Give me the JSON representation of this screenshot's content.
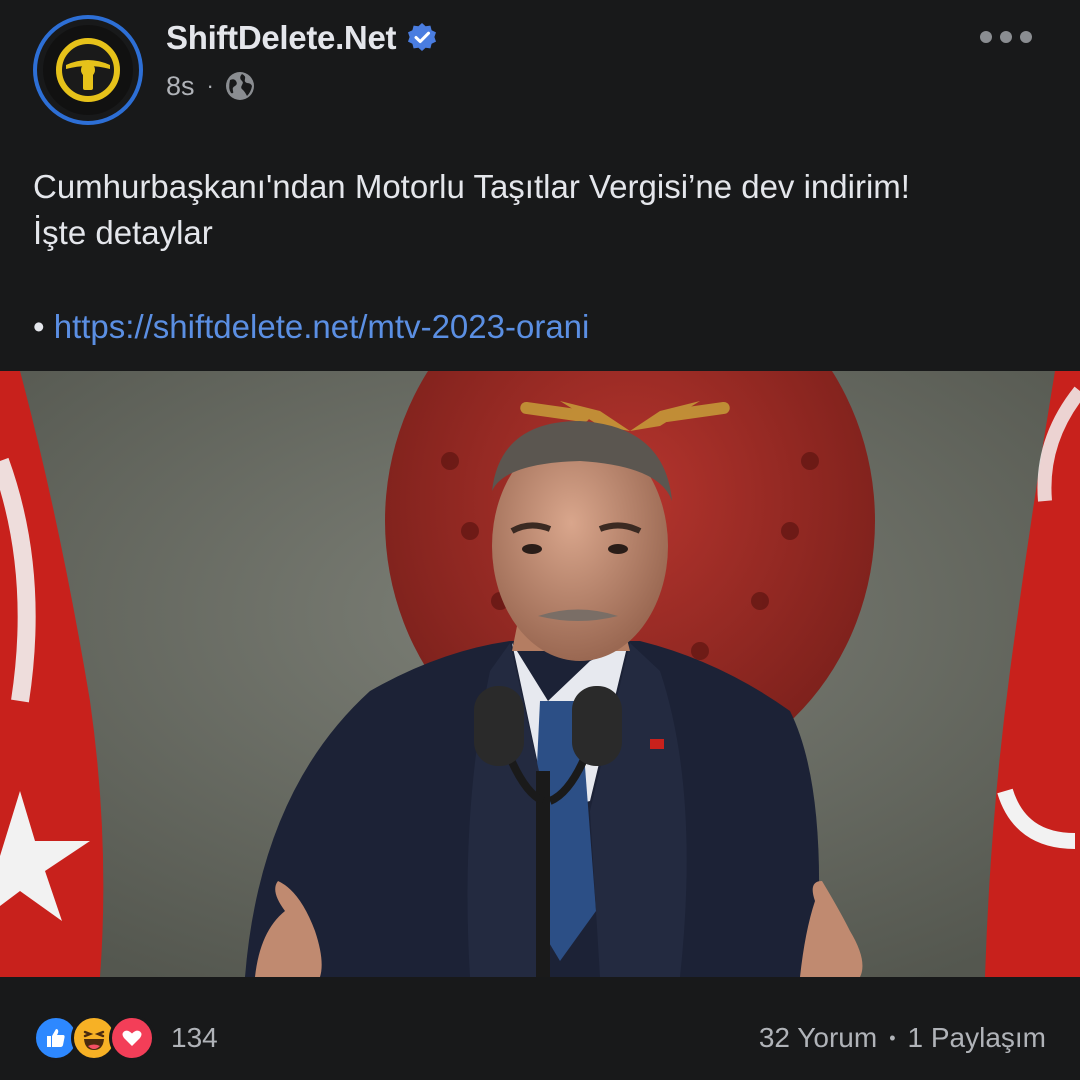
{
  "header": {
    "page_name": "ShiftDelete.Net",
    "time": "8s",
    "separator": "·",
    "avatar_icon": "shiftdelete-logo",
    "verified_icon": "verified-badge-icon",
    "audience_icon": "globe-icon",
    "more_icon": "more-options-icon"
  },
  "post": {
    "text_line1": "Cumhurbaşkanı'ndan Motorlu Taşıtlar Vergisi’ne dev indirim!",
    "text_line2": "İşte detaylar",
    "bullet": "•",
    "link": "https://shiftdelete.net/mtv-2023-orani"
  },
  "footer": {
    "reaction_icons": [
      "like-icon",
      "haha-icon",
      "love-icon"
    ],
    "reaction_count": "134",
    "comments": "32 Yorum",
    "separator": "•",
    "shares": "1 Paylaşım"
  },
  "colors": {
    "background": "#18191a",
    "text": "#e4e6eb",
    "secondary_text": "#b0b3b8",
    "link": "#5b8fe3",
    "avatar_ring": "#2d6fd6",
    "like_blue": "#2d88ff",
    "love_red": "#f33e58",
    "haha_yellow": "#f7b125"
  }
}
